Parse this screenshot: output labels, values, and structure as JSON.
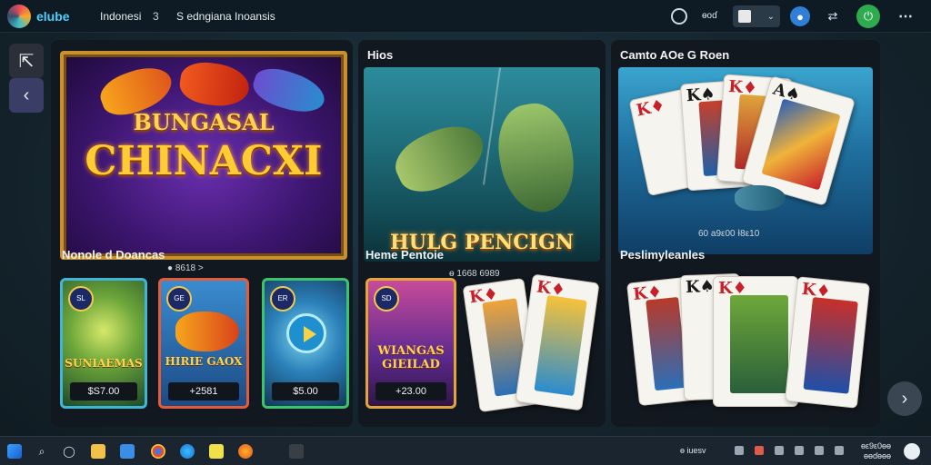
{
  "topbar": {
    "brand": "elube",
    "region": "Indonesi",
    "region_count": "3",
    "subtitle": "S edngiana Inoansis",
    "tool_text": "ɵoɗ",
    "icons": [
      "search-icon",
      "flag-selector",
      "user-icon",
      "link-icon",
      "power-icon",
      "more-icon"
    ]
  },
  "panels": [
    {
      "hero_line1": "BUNGASAL",
      "hero_line2": "CHINACXI",
      "hero_caption": "● 8618 >",
      "section": "Nonole d Doancas",
      "thumbs": [
        {
          "badge": "SL",
          "title": "SUNIAEMAS",
          "price": "$S7.00"
        },
        {
          "badge": "GE",
          "title": "HIRIE GAOX",
          "price": "+2581"
        },
        {
          "badge": "ER",
          "title": "",
          "price": "$5.00"
        }
      ]
    },
    {
      "title": "Hios",
      "hero_line1": "HULG PENCIGN",
      "hero_caption": "ɵ 1668 6989",
      "section": "Heme Pentoie",
      "thumbs": [
        {
          "badge": "SD",
          "title": "WIANGAS GIEILAD",
          "price": "+23.00"
        }
      ]
    },
    {
      "title": "Camto AOe G Roen",
      "hero_caption": "60 a9ε00 Ɨ8ε10",
      "section": "Peslimyleanles"
    }
  ],
  "taskbar": {
    "tray_text": "ɵ iuesv",
    "clock_line1": "ɵε9ε0ɵɵ",
    "clock_line2": "ɵɵɗɵɵɵ"
  }
}
